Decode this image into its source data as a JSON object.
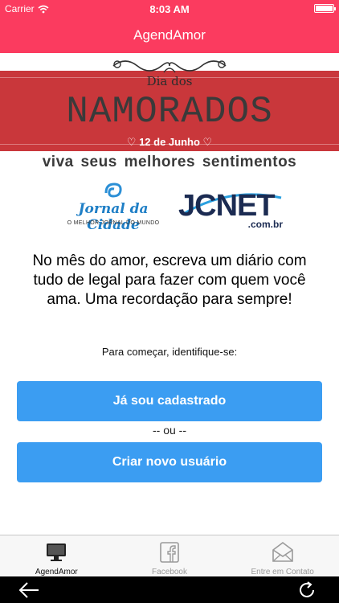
{
  "status_bar": {
    "carrier": "Carrier",
    "time": "8:03 AM"
  },
  "nav": {
    "title": "AgendAmor"
  },
  "banner": {
    "small_title": "Dia dos",
    "big_title": "NAMORADOS",
    "date": "♡ 12 de Junho ♡",
    "tagline": "viva seus melhores sentimentos",
    "band_color": "#c9373b"
  },
  "sponsors": {
    "jornal_name": "Jornal da Cidade",
    "jornal_sub": "O MELHOR JORNAL DO MUNDO",
    "jcnet_name": "JCNET",
    "jcnet_domain": ".com.br"
  },
  "main": {
    "message": "No mês do amor, escreva um diário com tudo de legal para fazer com quem você ama. Uma recordação para sempre!",
    "prompt": "Para começar, identifique-se:",
    "login_button": "Já sou cadastrado",
    "or_separator": "-- ou --",
    "register_button": "Criar novo usuário"
  },
  "tabs": [
    {
      "label": "AgendAmor",
      "icon": "monitor-icon",
      "active": true
    },
    {
      "label": "Facebook",
      "icon": "facebook-icon",
      "active": false
    },
    {
      "label": "Entre em Contato",
      "icon": "mail-icon",
      "active": false
    }
  ],
  "colors": {
    "primary": "#fb3b5f",
    "button": "#3b9df2"
  }
}
